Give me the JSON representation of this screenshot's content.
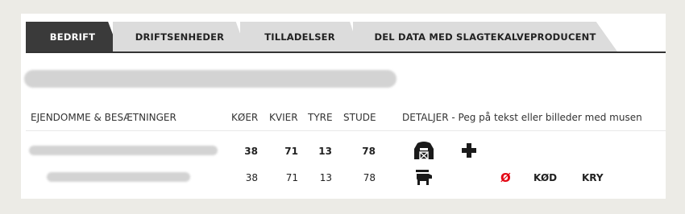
{
  "tabs": [
    {
      "label": "BEDRIFT",
      "active": true
    },
    {
      "label": "DRIFTSENHEDER",
      "active": false
    },
    {
      "label": "TILLADELSER",
      "active": false
    },
    {
      "label": "DEL DATA MED SLAGTEKALVEPRODUCENT",
      "active": false
    }
  ],
  "table": {
    "headers": {
      "property": "EJENDOMME & BESÆTNINGER",
      "cows": "KØER",
      "heifers": "KVIER",
      "bulls": "TYRE",
      "steers": "STUDE",
      "details": "DETALJER - Peg på tekst eller billeder med musen"
    },
    "rows": [
      {
        "cows": "38",
        "heifers": "71",
        "bulls": "13",
        "steers": "78",
        "icons": [
          "barn-icon",
          "plus-icon"
        ]
      },
      {
        "cows": "38",
        "heifers": "71",
        "bulls": "13",
        "steers": "78",
        "icons": [
          "cattle-icon"
        ],
        "flags": [
          "Ø",
          "KØD",
          "KRY"
        ]
      }
    ]
  },
  "colors": {
    "active_tab": "#3a3a3a",
    "inactive_tab": "#dcdcdc",
    "accent_red": "#e30613"
  }
}
